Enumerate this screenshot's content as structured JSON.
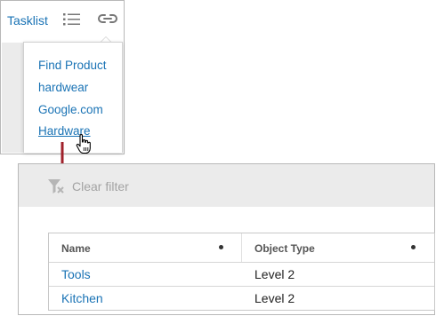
{
  "top_panel": {
    "tab_label": "Tasklist",
    "toolbar_icons": [
      "list-icon",
      "link-icon"
    ],
    "dropdown_items": [
      "Find Product",
      "hardwear",
      "Google.com",
      "Hardware"
    ],
    "hovered_item": "Hardware"
  },
  "bottom_panel": {
    "clear_filter_label": "Clear filter",
    "grid": {
      "columns": [
        "Name",
        "Object Type"
      ],
      "rows": [
        {
          "name": "Tools",
          "object_type": "Level 2"
        },
        {
          "name": "Kitchen",
          "object_type": "Level 2"
        }
      ]
    }
  },
  "colors": {
    "link": "#1a73b5",
    "arrow": "#a0212b",
    "muted_text": "#a3a3a3",
    "background_grey": "#ebebeb"
  }
}
